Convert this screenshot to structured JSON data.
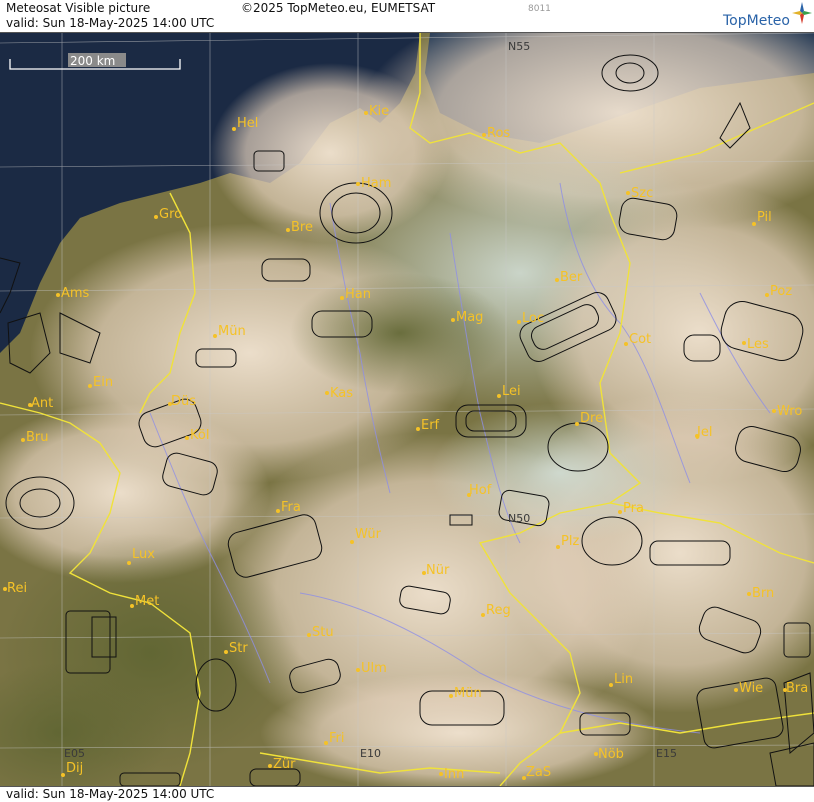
{
  "header": {
    "product_title": "Meteosat Visible picture",
    "copyright": "©2025 TopMeteo.eu, EUMETSAT",
    "image_code": "8011",
    "valid_line": "valid:  Sun  18-May-2025  14:00 UTC",
    "logo_text": "TopMeteo"
  },
  "footer": {
    "valid_line": "valid:  Sun  18-May-2025  14:00 UTC"
  },
  "scale_bar": {
    "label": "200 km"
  },
  "grid_labels": {
    "n55": "N55",
    "n50": "N50",
    "e05": "E05",
    "e10": "E10",
    "e15": "E15"
  },
  "cities": {
    "hel": "Hel",
    "kie": "Kie",
    "ros": "Ros",
    "ham": "Ham",
    "szc": "Szc",
    "gro": "Gro",
    "bre": "Bre",
    "pil": "Pil",
    "ams": "Ams",
    "han": "Han",
    "ber": "Ber",
    "poz": "Poz",
    "mun": "Mün",
    "mag": "Mag",
    "loc": "Loc",
    "cot": "Cot",
    "les": "Les",
    "ein": "Ein",
    "kas": "Kas",
    "lei": "Lei",
    "ant": "Ant",
    "dus": "Düs",
    "bru": "Bru",
    "kol": "Köl",
    "dre": "Dre",
    "wro": "Wro",
    "erf": "Erf",
    "jel": "Jel",
    "hof": "Hof",
    "fra": "Fra",
    "pra": "Pra",
    "wur": "Wür",
    "plz": "Plz",
    "lux": "Lux",
    "nur": "Nür",
    "rei": "Rei",
    "met": "Met",
    "reg": "Reg",
    "brn": "Brn",
    "stu": "Stu",
    "str": "Str",
    "ulm": "Ulm",
    "mun2": "Mün",
    "lin": "Lin",
    "wie": "Wie",
    "bra": "Bra",
    "fri": "Fri",
    "dij": "Dij",
    "zur": "Zür",
    "inn": "Inn",
    "zas": "ZaS",
    "nob": "Nöb"
  },
  "colors": {
    "sea": "#1b2a44",
    "land_green": "#6f6a3a",
    "cloud": "#e8d8c4",
    "border": "#f0e23a",
    "river": "#8f8fe6",
    "city": "#f5c227",
    "grid": "#c8c8c8",
    "storm_outline": "#111111"
  }
}
